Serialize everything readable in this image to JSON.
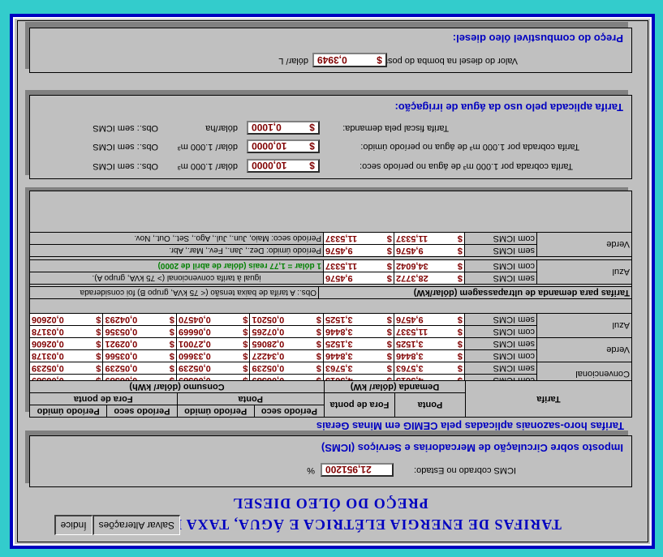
{
  "buttons": {
    "indice": "Índice",
    "salvar": "Salvar Alterações"
  },
  "title": {
    "line1": "TARIFAS DE ENERGIA ELÉTRICA E ÁGUA, TAXA DE ICMS E",
    "line2": "PREÇO DO ÓLEO DIESEL"
  },
  "icms": {
    "title": "Imposto sobre Circulação de Mercadorias e Serviços (ICMS)",
    "label": "ICMS cobrado no Estado:",
    "value": "21,951200",
    "unit": "%"
  },
  "cemig": {
    "title": "Tarifas horo-sazonais aplicadas pela CEMIG em Minas Gerais",
    "header_tarifa": "Tarifa",
    "header_demanda": "Demanda (dólar/ kW)",
    "header_consumo": "Consumo (dólar/ kWh)",
    "header_ponta": "Ponta",
    "header_fora_ponta": "Fora de ponta",
    "header_fora_de_ponta2": "Fora de ponta",
    "header_ponta2": "Ponta",
    "header_seco": "Período seco",
    "header_umido": "Período úmido",
    "header_seco2": "Período seco",
    "header_umido2": "Período úmido",
    "currency": "$",
    "rows": [
      {
        "group": "Azul",
        "tipo": "sem ICMS",
        "v": [
          "9,4576",
          "3,1525",
          "0,05201",
          "0,04570",
          "0,04293",
          "0,02606"
        ]
      },
      {
        "group": "",
        "tipo": "com ICMS",
        "v": [
          "11,5337",
          "3,8446",
          "0,07265",
          "0,06669",
          "0,05356",
          "0,03178"
        ]
      },
      {
        "group": "Verde",
        "tipo": "sem ICMS",
        "v": [
          "3,1525",
          "3,1525",
          "0,28065",
          "0,27001",
          "0,02921",
          "0,02606"
        ]
      },
      {
        "group": "",
        "tipo": "com ICMS",
        "v": [
          "3,8446",
          "3,8446",
          "0,34227",
          "0,33660",
          "0,03566",
          "0,03178"
        ]
      },
      {
        "group": "Convencional",
        "tipo": "sem ICMS",
        "v": [
          "3,5763",
          "3,5763",
          "0,05239",
          "0,05239",
          "0,05239",
          "0,05239"
        ]
      },
      {
        "group": "",
        "tipo": "com ICMS",
        "v": [
          "4,3613",
          "4,3613",
          "0,06389",
          "0,06389",
          "0,06389",
          "0,06389"
        ]
      }
    ],
    "ultra_title": "Tarifas para demanda de ultrapassagem (dólar/kW)",
    "obs_title": "Obs.: A tarifa de baixa tensão (< 75 kVA, grupo B) foi considerada",
    "obs_line2": "igual à tarifa convencional (> 75 kVA, grupo A).",
    "dolar_note": "1 dólar = 1,77 reais (dólar de abril de 2000)",
    "periodo_umido": "Período úmido: Dez., Jan., Fev., Mar., Abr.",
    "periodo_seco": "Período seco: Maio, Jun., Jul., Ago., Set., Out., Nov.",
    "ultra_rows": [
      {
        "group": "Azul",
        "tipo": "sem ICMS",
        "v": [
          "28,3772",
          "9,4576"
        ]
      },
      {
        "group": "",
        "tipo": "com ICMS",
        "v": [
          "34,6042",
          "11,5337"
        ]
      },
      {
        "group": "Verde",
        "tipo": "sem ICMS",
        "v": [
          "9,4576",
          "9,4576"
        ]
      },
      {
        "group": "",
        "tipo": "com ICMS",
        "v": [
          "11,5337",
          "11,5337"
        ]
      }
    ]
  },
  "agua": {
    "title": "Tarifa aplicada pelo uso da água de irrigação:",
    "rows": [
      {
        "label": "Tarifa fiscal pela demanda:",
        "value": "0,1000",
        "unit": "dólar/ha",
        "obs": "Obs.: sem ICMS"
      },
      {
        "label": "Tarifa cobrada por 1.000 m³ de água no período úmido:",
        "value": "10,0000",
        "unit": "dólar/ 1.000 m³",
        "obs": "Obs.: sem ICMS"
      },
      {
        "label": "Tarifa cobrada por 1.000 m³ de água no período seco:",
        "value": "10,0000",
        "unit": "dólar/ 1.000 m³",
        "obs": "Obs.: sem ICMS"
      }
    ]
  },
  "diesel": {
    "title": "Preço do combustível óleo diesel:",
    "label": "Valor do diesel na bomba do posto:",
    "value": "0,3949",
    "unit": "dólar/ L"
  }
}
